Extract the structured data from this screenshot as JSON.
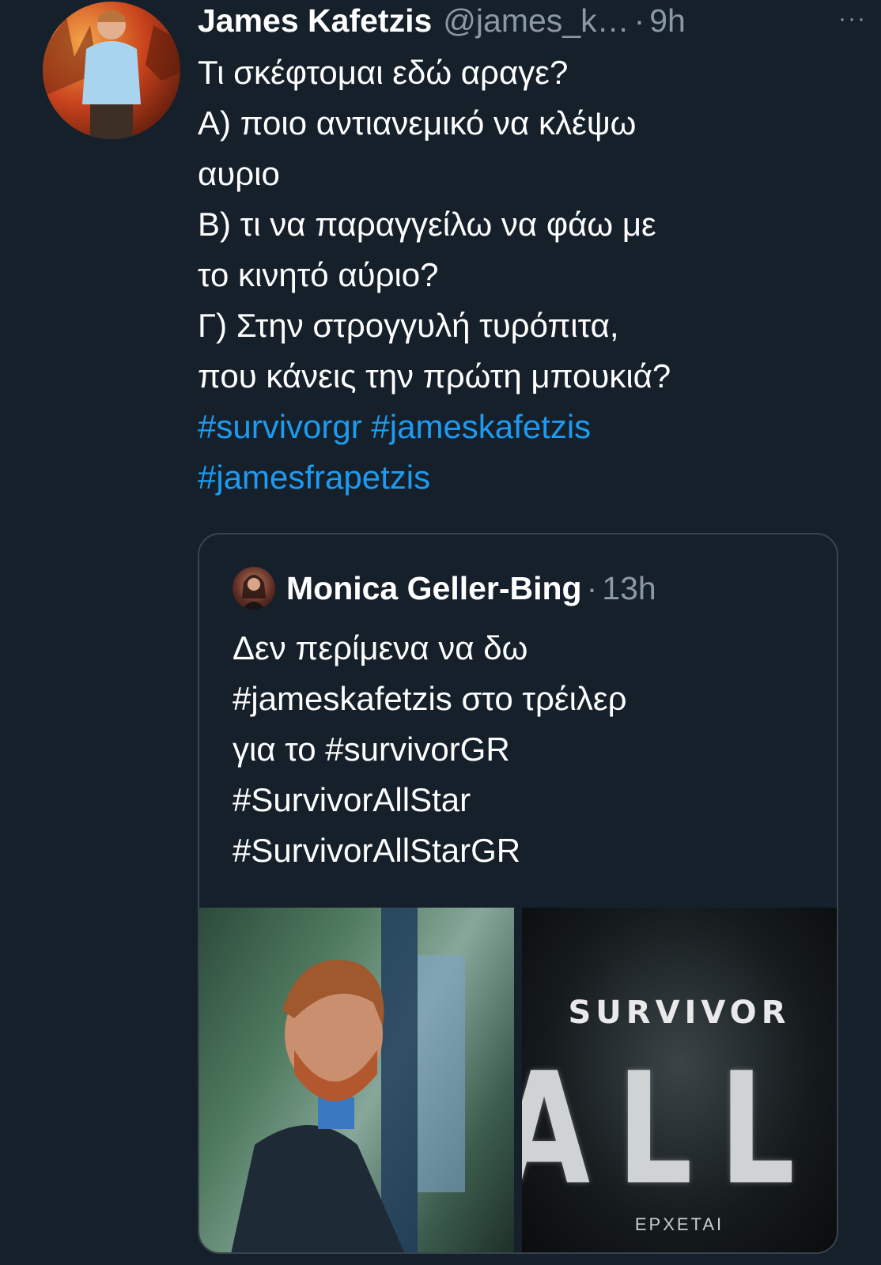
{
  "tweet": {
    "author_name": "James Kafetzis",
    "author_handle": "@james_k…",
    "separator": "·",
    "time": "9h",
    "more_glyph": "···",
    "lines": [
      {
        "text": "Τι σκέφτομαι εδώ αραγε?",
        "type": "text"
      },
      {
        "text": "Α) ποιο αντιανεμικό να κλέψω",
        "type": "text"
      },
      {
        "text": "αυριο",
        "type": "text"
      },
      {
        "text": "Β) τι να παραγγείλω να φάω με",
        "type": "text"
      },
      {
        "text": "το κινητό αύριο?",
        "type": "text"
      },
      {
        "text": "Γ) Στην στρογγυλή τυρόπιτα,",
        "type": "text"
      },
      {
        "text": "που κάνεις την πρώτη μπουκιά?",
        "type": "text"
      }
    ],
    "hashtags_line1": [
      "#survivorgr",
      "#jameskafetzis"
    ],
    "hashtags_line2": [
      "#jamesfrapetzis"
    ]
  },
  "quote": {
    "author_name": "Monica Geller-Bing",
    "separator": "·",
    "time": "13h",
    "lines": [
      "Δεν περίμενα να δω",
      "#jameskafetzis στο τρέιλερ",
      "για το #survivorGR",
      "#SurvivorAllStar",
      "#SurvivorAllStarGR"
    ],
    "media": {
      "right_image": {
        "logo_word": "SURVIVOR",
        "big_text": "ALL STAR",
        "sub_text": "ΕΡΧΕΤΑΙ"
      }
    }
  },
  "colors": {
    "background": "#15202b",
    "text": "#ffffff",
    "secondary": "#8b98a5",
    "link": "#1d9bf0",
    "border": "#38444d"
  }
}
